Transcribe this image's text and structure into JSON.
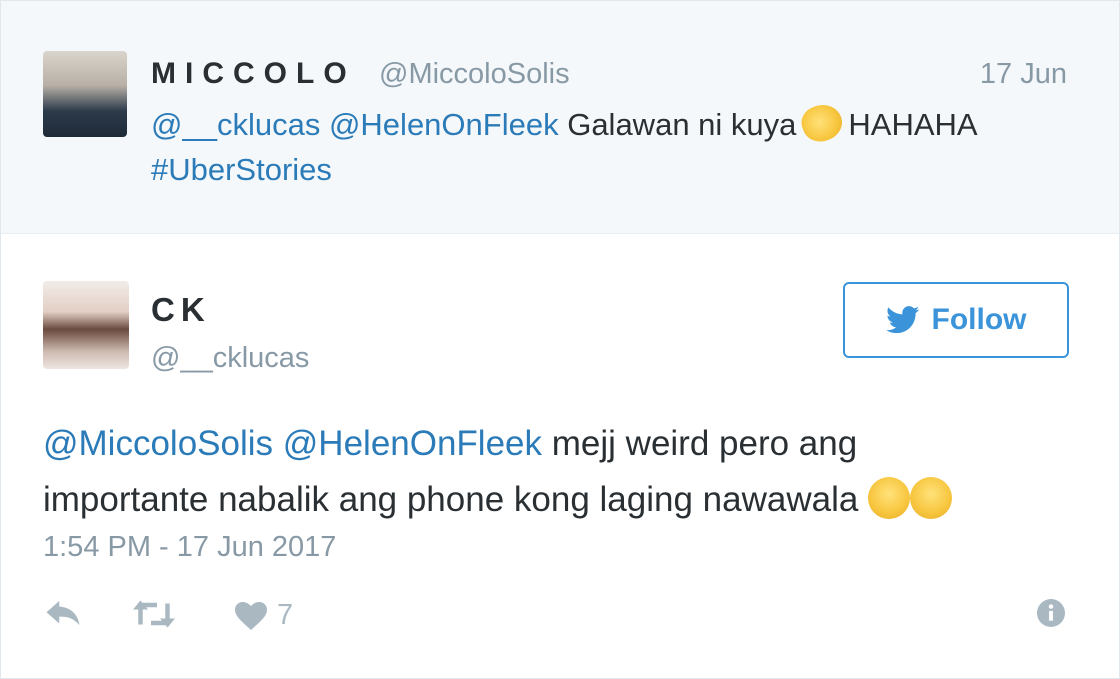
{
  "parent_tweet": {
    "display_name": "MICCOLO",
    "handle": "@MiccoloSolis",
    "date": "17 Jun",
    "mention_1": "@__cklucas",
    "mention_2": "@HelenOnFleek",
    "text_part_1": "Galawan ni kuya",
    "emoji_1": "clapping-hands-emoji",
    "text_part_2": "HAHAHA",
    "hashtag": "#UberStories"
  },
  "main_tweet": {
    "display_name": "CK",
    "handle": "@__cklucas",
    "follow_label": "Follow",
    "mention_1": "@MiccoloSolis",
    "mention_2": "@HelenOnFleek",
    "text_line_1": "mejj weird pero ang",
    "text_line_2": "importante nabalik ang phone kong laging nawawala",
    "emojis": [
      "tears-of-joy-emoji",
      "tears-of-joy-emoji"
    ],
    "timestamp": "1:54 PM - 17 Jun 2017",
    "likes_count": "7"
  },
  "icons": {
    "reply": "reply-icon",
    "retweet": "retweet-icon",
    "like": "heart-icon",
    "info": "info-icon",
    "follow": "twitter-bird-icon"
  },
  "colors": {
    "link": "#2b7bb9",
    "follow_accent": "#3b94d9",
    "muted": "#8899a6",
    "action_icon": "#aab8c2",
    "parent_background": "#f5f8fa"
  }
}
